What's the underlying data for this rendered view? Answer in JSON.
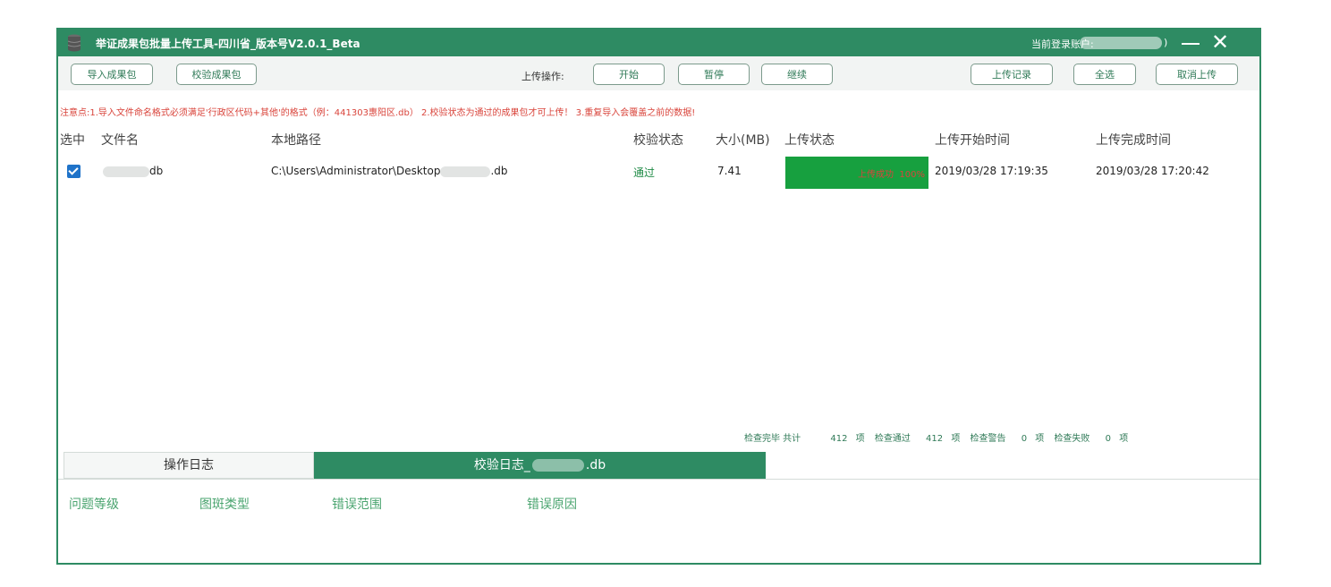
{
  "window": {
    "title": "举证成果包批量上传工具-四川省_版本号V2.0.1_Beta",
    "account_label": "当前登录账户:",
    "account_tail": ")",
    "close_glyph": "✕"
  },
  "toolbar": {
    "import_label": "导入成果包",
    "verify_label": "校验成果包",
    "upload_ops_label": "上传操作:",
    "start_label": "开始",
    "pause_label": "暂停",
    "continue_label": "继续",
    "history_label": "上传记录",
    "select_all_label": "全选",
    "cancel_upload_label": "取消上传"
  },
  "notice": "注意点:1.导入文件命名格式必须满足'行政区代码+其他'的格式（例：441303惠阳区.db） 2.校验状态为通过的成果包才可上传！ 3.重复导入会覆盖之前的数据!",
  "table": {
    "headers": [
      "选中",
      "文件名",
      "本地路径",
      "校验状态",
      "大小(MB)",
      "上传状态",
      "上传开始时间",
      "上传完成时间"
    ],
    "rows": [
      {
        "checked": true,
        "file_suffix": "db",
        "path_prefix": "C:\\Users\\Administrator\\Desktop",
        "path_suffix": ".db",
        "status": "通过",
        "size": "7.41",
        "upload_status": "上传成功",
        "progress_text": "100%",
        "progress": 1.0,
        "start_time": "2019/03/28 17:19:35",
        "end_time": "2019/03/28 17:20:42"
      }
    ]
  },
  "summary": {
    "done": "检查完毕 共计",
    "total": "412",
    "item1": "项",
    "pass_label": "检查通过",
    "pass": "412",
    "item2": "项",
    "warn_label": "检查警告",
    "warn": "0",
    "item3": "项",
    "fail_label": "检查失败",
    "fail": "0",
    "item4": "项"
  },
  "tabs": {
    "ops_log": "操作日志",
    "check_log_prefix": "校验日志_",
    "check_log_suffix": ".db"
  },
  "log_headers": [
    "问题等级",
    "图斑类型",
    "错误范围",
    "错误原因"
  ],
  "colors": {
    "accent": "#2e8b63",
    "success_fill": "#17a03f",
    "notice_red": "#d9443b",
    "checkbox_blue": "#1f73c9"
  }
}
